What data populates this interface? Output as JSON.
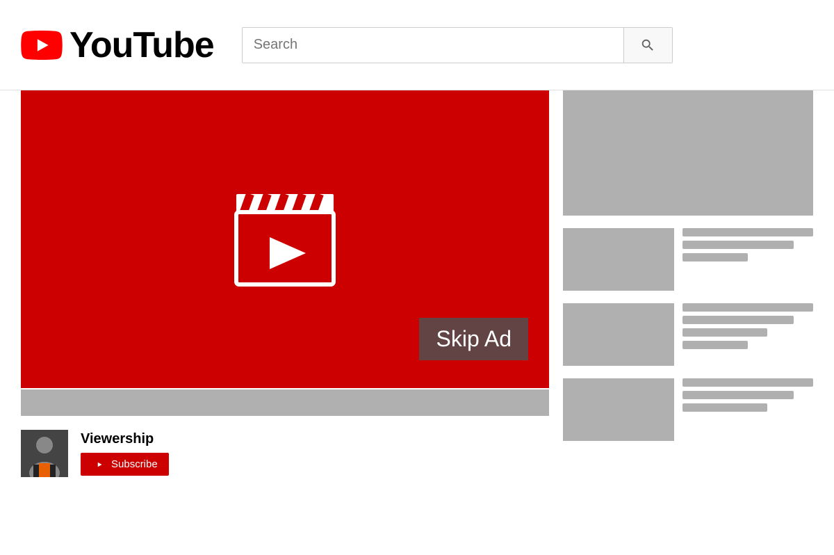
{
  "header": {
    "logo_text": "YouTube",
    "search_placeholder": "Search"
  },
  "video": {
    "skip_ad_label": "Skip Ad"
  },
  "channel": {
    "name": "Viewership",
    "subscribe_label": "Subscribe"
  }
}
